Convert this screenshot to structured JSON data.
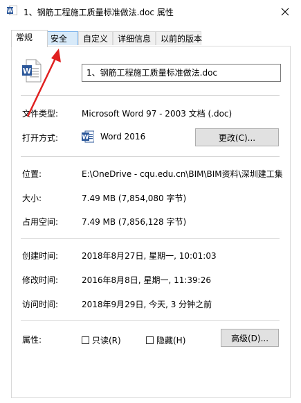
{
  "window": {
    "title": "1、钢筋工程施工质量标准做法.doc 属性"
  },
  "tabs": [
    {
      "label": "常规",
      "active": true
    },
    {
      "label": "安全",
      "active": false
    },
    {
      "label": "自定义",
      "active": false
    },
    {
      "label": "详细信息",
      "active": false
    },
    {
      "label": "以前的版本",
      "active": false
    }
  ],
  "general": {
    "file_name": "1、钢筋工程施工质量标准做法.doc",
    "file_type_label": "文件类型:",
    "file_type_value": "Microsoft Word 97 - 2003 文档 (.doc)",
    "open_with_label": "打开方式:",
    "open_with_value": "Word 2016",
    "change_button": "更改(C)...",
    "location_label": "位置:",
    "location_value": "E:\\OneDrive - cqu.edu.cn\\BIM\\BIM资料\\深圳建工集",
    "size_label": "大小:",
    "size_value": "7.49 MB (7,854,080 字节)",
    "size_on_disk_label": "占用空间:",
    "size_on_disk_value": "7.49 MB (7,856,128 字节)",
    "created_label": "创建时间:",
    "created_value": "2018年8月27日, 星期一, 10:01:03",
    "modified_label": "修改时间:",
    "modified_value": "2016年8月8日, 星期一, 11:39:26",
    "accessed_label": "访问时间:",
    "accessed_value": "2018年9月29日, 今天, 3 分钟之前",
    "attributes_label": "属性:",
    "readonly_label": "只读(R)",
    "hidden_label": "隐藏(H)",
    "advanced_button": "高级(D)..."
  },
  "colors": {
    "annotation_arrow": "#e02020",
    "word_blue": "#2b579a",
    "tab_hover": "#d8eaf9"
  }
}
